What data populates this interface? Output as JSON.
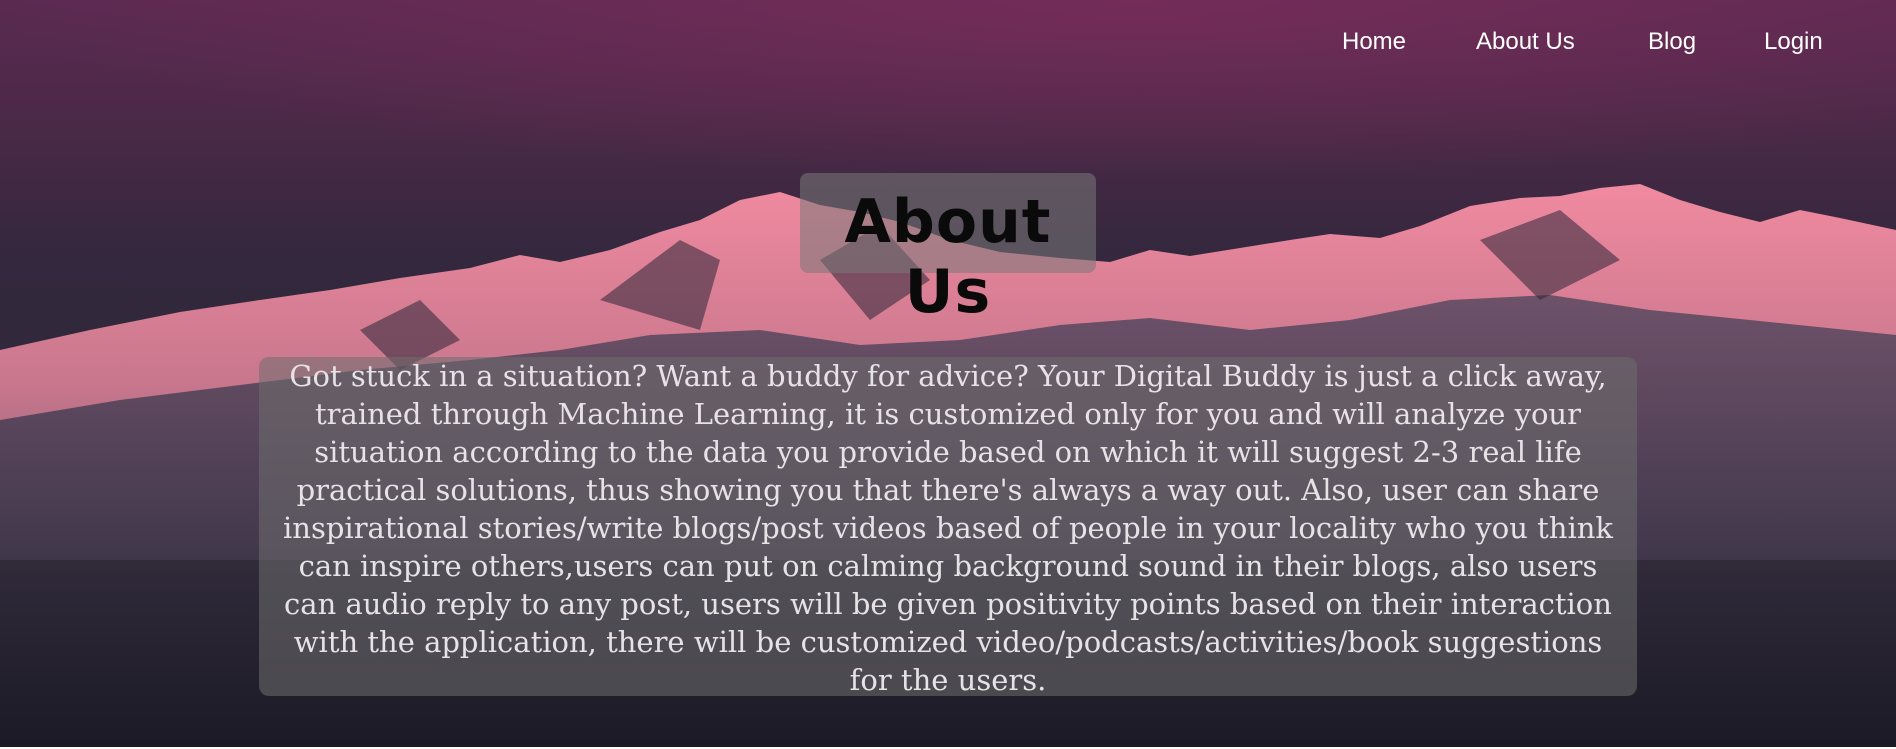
{
  "nav": {
    "items": [
      {
        "label": "Home"
      },
      {
        "label": "About Us"
      },
      {
        "label": "Blog"
      },
      {
        "label": "Login"
      }
    ]
  },
  "hero": {
    "title": "About Us",
    "description": "Got stuck in a situation? Want a buddy for advice? Your Digital Buddy is just a click away, trained through Machine Learning, it is customized only for you and will analyze your situation according to the data you provide based on which it will suggest 2-3 real life practical solutions, thus showing you that there's always a way out. Also, user can share inspirational stories/write blogs/post videos based of people in your locality who you think can inspire others,users can put on calming background sound in their blogs, also users can audio reply to any post, users will be given positivity points based on their interaction with the application, there will be customized video/podcasts/activities/book suggestions for the users."
  },
  "colors": {
    "nav_text": "#ffffff",
    "title_text": "#0a0a0a",
    "body_text": "#e7e2e6",
    "sky_top": "#5a2a50",
    "mountain_peak": "#e87f95"
  }
}
